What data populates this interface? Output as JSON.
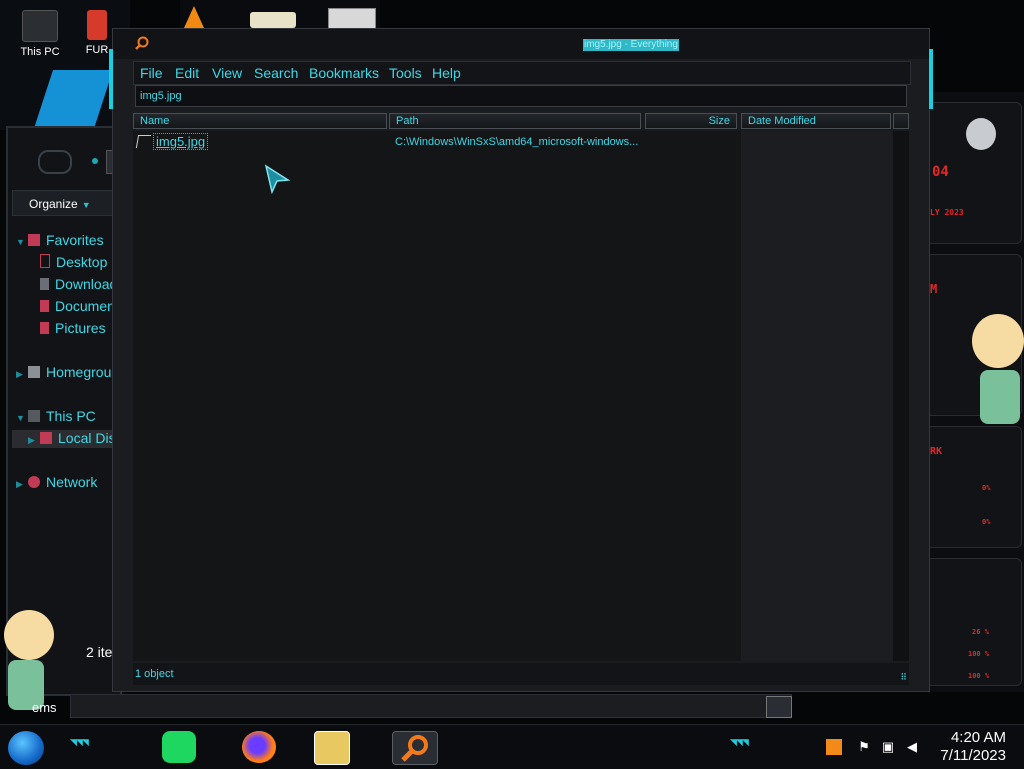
{
  "desktop": {
    "icons": [
      {
        "label": "This PC"
      },
      {
        "label": "FUR"
      }
    ]
  },
  "explorer": {
    "organize_label": "Organize",
    "tree": [
      {
        "label": "Favorites"
      },
      {
        "label": "Desktop"
      },
      {
        "label": "Download"
      },
      {
        "label": "Documen"
      },
      {
        "label": "Pictures"
      },
      {
        "label": "Homegroup"
      },
      {
        "label": "This PC"
      },
      {
        "label": "Local Disl"
      },
      {
        "label": "Network"
      }
    ],
    "item_count": "2 ite",
    "status": "ems"
  },
  "everything": {
    "title": "img5.jpg - Everything",
    "menu": [
      "File",
      "Edit",
      "View",
      "Search",
      "Bookmarks",
      "Tools",
      "Help"
    ],
    "search_value": "img5.jpg",
    "columns": [
      "Name",
      "Path",
      "Size",
      "Date Modified"
    ],
    "results": [
      {
        "name": "img5.jpg",
        "path": "C:\\Windows\\WinSxS\\amd64_microsoft-windows...",
        "size": "",
        "date_modified": ""
      }
    ],
    "status": "1 object"
  },
  "right_panel": {
    "texts": [
      "04",
      "LY 2023",
      "M",
      "RK",
      "0%",
      "0%",
      "26 %",
      "100 %",
      "100 %"
    ]
  },
  "taskbar": {
    "time": "4:20 AM",
    "date": "7/11/2023"
  },
  "colors": {
    "accent": "#3fd8e6",
    "hud_red": "#e0282a",
    "window_bg": "#1a1c20"
  }
}
